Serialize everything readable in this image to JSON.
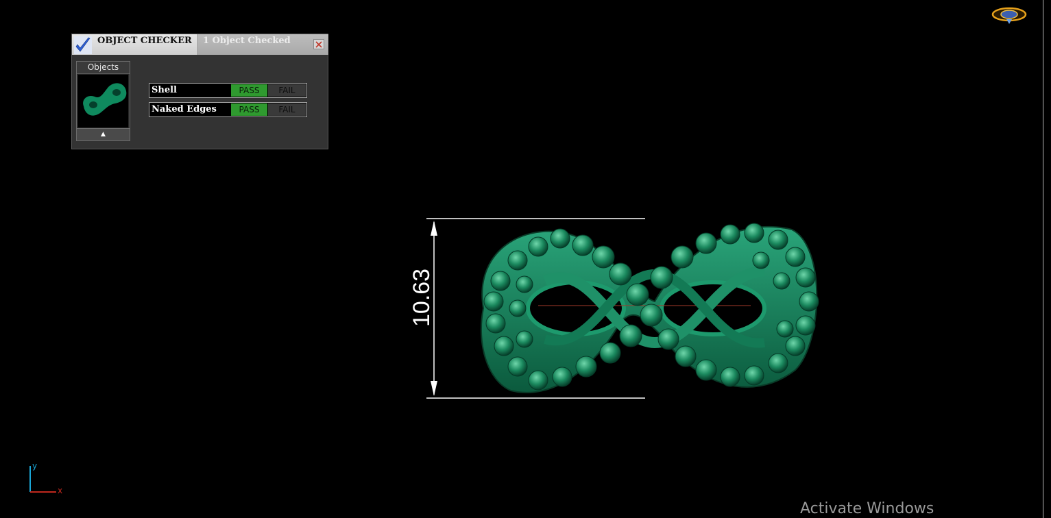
{
  "checker": {
    "title": "OBJECT CHECKER",
    "count_label": "1  Object Checked",
    "objects_label": "Objects",
    "scroll_glyph": "▲",
    "rows": [
      {
        "name": "Shell",
        "pass_label": "PASS",
        "fail_label": "FAIL",
        "status": "pass"
      },
      {
        "name": "Naked Edges",
        "pass_label": "PASS",
        "fail_label": "FAIL",
        "status": "pass"
      }
    ]
  },
  "viewport": {
    "dimension_value": "10.63",
    "axis_y_label": "y",
    "axis_x_label": "x"
  },
  "os": {
    "watermark": "Activate Windows"
  },
  "colors": {
    "pass_green": "#2f9a2f",
    "model_green": "#1f7a5a",
    "background": "#000000"
  },
  "icons": [
    "checkmark-icon",
    "close-icon",
    "navigation-compass-icon",
    "axis-icon"
  ]
}
